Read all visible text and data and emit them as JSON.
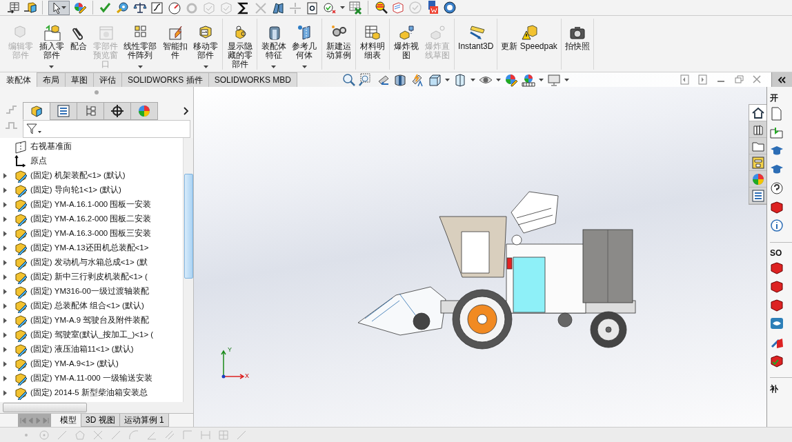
{
  "command_groups": [
    {
      "buttons": [
        {
          "label": "编辑零部件",
          "disabled": true,
          "dropdown": false
        },
        {
          "label": "插入零部件",
          "disabled": false,
          "dropdown": true
        },
        {
          "label": "配合",
          "disabled": false,
          "dropdown": false
        },
        {
          "label": "零部件预览窗口",
          "disabled": true,
          "dropdown": false
        },
        {
          "label": "线性零部件阵列",
          "disabled": false,
          "dropdown": true
        },
        {
          "label": "智能扣件",
          "disabled": false,
          "dropdown": false
        },
        {
          "label": "移动零部件",
          "disabled": false,
          "dropdown": true
        }
      ]
    },
    {
      "buttons": [
        {
          "label": "显示隐藏的零部件",
          "disabled": false,
          "dropdown": false
        }
      ]
    },
    {
      "buttons": [
        {
          "label": "装配体特征",
          "disabled": false,
          "dropdown": true
        },
        {
          "label": "参考几何体",
          "disabled": false,
          "dropdown": true
        }
      ]
    },
    {
      "buttons": [
        {
          "label": "新建运动算例",
          "disabled": false,
          "dropdown": false
        }
      ]
    },
    {
      "buttons": [
        {
          "label": "材料明细表",
          "disabled": false,
          "dropdown": false
        }
      ]
    },
    {
      "buttons": [
        {
          "label": "爆炸视图",
          "disabled": false,
          "dropdown": false
        },
        {
          "label": "爆炸直线草图",
          "disabled": true,
          "dropdown": false
        }
      ]
    },
    {
      "buttons": [
        {
          "label": "Instant3D",
          "disabled": false,
          "dropdown": false
        }
      ]
    },
    {
      "buttons": [
        {
          "label": "更新 Speedpak",
          "disabled": false,
          "dropdown": false
        }
      ]
    },
    {
      "buttons": [
        {
          "label": "拍快照",
          "disabled": false,
          "dropdown": false
        }
      ]
    }
  ],
  "ribbon_tabs": [
    {
      "label": "装配体",
      "selected": true
    },
    {
      "label": "布局",
      "selected": false
    },
    {
      "label": "草图",
      "selected": false
    },
    {
      "label": "评估",
      "selected": false
    },
    {
      "label": "SOLIDWORKS 插件",
      "selected": false
    },
    {
      "label": "SOLIDWORKS MBD",
      "selected": false
    }
  ],
  "feature_tabs": [
    {
      "selected": true
    },
    {
      "selected": false
    },
    {
      "selected": false
    },
    {
      "selected": false
    },
    {
      "selected": false
    }
  ],
  "tree": {
    "items": [
      {
        "kind": "plane",
        "label": "右视基准面"
      },
      {
        "kind": "origin",
        "label": "原点"
      },
      {
        "kind": "component",
        "label": "(固定) 机架装配<1> (默认)",
        "expanded": false
      },
      {
        "kind": "component",
        "label": "(固定) 导向轮1<1> (默认)",
        "expanded": false
      },
      {
        "kind": "component",
        "label": "(固定) YM-A.16.1-000 围板一安装",
        "expanded": false
      },
      {
        "kind": "component",
        "label": "(固定) YM-A.16.2-000 围板二安装",
        "expanded": false
      },
      {
        "kind": "component",
        "label": "(固定) YM-A.16.3-000 围板三安装",
        "expanded": false
      },
      {
        "kind": "component",
        "label": "(固定) YM-A.13还田机总装配<1>",
        "expanded": false
      },
      {
        "kind": "component",
        "label": "(固定) 发动机与水箱总成<1> (默",
        "expanded": false
      },
      {
        "kind": "component",
        "label": "(固定) 新中三行剥皮机装配<1> (",
        "expanded": false
      },
      {
        "kind": "component",
        "label": "(固定) YM316-00一级过渡轴装配",
        "expanded": false
      },
      {
        "kind": "component",
        "label": "(固定) 总装配体  组合<1> (默认)",
        "expanded": false
      },
      {
        "kind": "component",
        "label": "(固定) YM-A.9 驾驶台及附件装配",
        "expanded": false
      },
      {
        "kind": "component",
        "label": "(固定) 驾驶室(默认_按加工_)<1> (",
        "expanded": false
      },
      {
        "kind": "component",
        "label": "(固定) 液压油箱11<1> (默认)",
        "expanded": false
      },
      {
        "kind": "component",
        "label": "(固定) YM-A.9<1> (默认)",
        "expanded": false
      },
      {
        "kind": "component",
        "label": "(固定) YM-A.11-000 一级输送安装",
        "expanded": false
      },
      {
        "kind": "component",
        "label": "(固定) 2014-5 新型柴油箱安装总",
        "expanded": false
      }
    ]
  },
  "bottom_tabs": [
    {
      "label": "模型",
      "selected": true
    },
    {
      "label": "3D 视图",
      "selected": false
    },
    {
      "label": "运动算例 1",
      "selected": false
    }
  ],
  "triad": {
    "y_label": "Y",
    "x_label": "X"
  },
  "task_tabs": [
    {
      "selected": true
    },
    {
      "selected": false
    },
    {
      "selected": false
    },
    {
      "selected": false
    },
    {
      "selected": false
    },
    {
      "selected": false
    }
  ],
  "task_pane": {
    "sections": [
      {
        "heading": "开"
      },
      {
        "heading": "SO"
      },
      {
        "heading": "补"
      }
    ]
  }
}
